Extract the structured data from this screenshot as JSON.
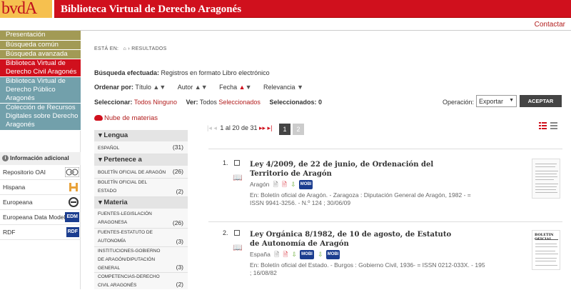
{
  "header": {
    "logo": "bvdA",
    "site_title": "Biblioteca Virtual de Derecho Aragonés",
    "contact_label": "Contactar"
  },
  "colors": {
    "brand_red": "#d0101d",
    "logo_yellow": "#f6c04f",
    "menu_olive": "#a29a55",
    "menu_teal": "#72a0ab",
    "link_red": "#b21d1d"
  },
  "sidebar": {
    "menu": [
      "Presentación",
      "Búsqueda común",
      "Búsqueda avanzada",
      "Biblioteca Virtual de Derecho Civil Aragonés",
      "Biblioteca Virtual de Derecho Público Aragonés",
      "Colección de Recursos Digitales sobre Derecho Aragonés"
    ],
    "additional_title": "Información adicional",
    "additional": [
      {
        "label": "Repositorio OAI",
        "icon": "oai-logo"
      },
      {
        "label": "Hispana",
        "icon": "hispana-logo"
      },
      {
        "label": "Europeana",
        "icon": "europeana-logo"
      },
      {
        "label": "Europeana Data Model",
        "icon": "edm-logo",
        "badge": "EDM"
      },
      {
        "label": "RDF",
        "icon": "rdf-logo",
        "badge": "RDF"
      }
    ]
  },
  "breadcrumb": {
    "prefix": "ESTÁ EN:",
    "home_icon": "home-icon",
    "current": "RESULTADOS"
  },
  "search": {
    "label": "Búsqueda efectuada:",
    "value": "Registros en formato Libro electrónico"
  },
  "order": {
    "label": "Ordenar por:",
    "fields": [
      "Título",
      "Autor",
      "Fecha",
      "Relevancia"
    ]
  },
  "selection": {
    "label": "Seleccionar:",
    "all": "Todos",
    "none": "Ninguno",
    "view_label": "Ver:",
    "view_all": "Todos",
    "view_selected": "Seleccionados",
    "selected_label": "Seleccionados: 0"
  },
  "operation": {
    "label": "Operación:",
    "value": "Exportar",
    "button": "ACEPTAR"
  },
  "nube": "Nube de materias",
  "facets": {
    "lengua": {
      "title": "Lengua",
      "items": [
        {
          "label": "ESPAÑOL",
          "count": "(31)"
        }
      ]
    },
    "pertenece": {
      "title": "Pertenece a",
      "items": [
        {
          "label": "BOLETÍN OFICIAL DE ARAGÓN",
          "count": "(26)"
        },
        {
          "label": "BOLETÍN OFICIAL DEL ESTADO",
          "count": "(2)"
        }
      ]
    },
    "materia": {
      "title": "Materia",
      "items": [
        {
          "label": "FUENTES-LEGISLACIÓN ARAGONESA",
          "count": "(26)"
        },
        {
          "label": "FUENTES-ESTATUTO DE AUTONOMÍA",
          "count": "(3)"
        },
        {
          "label": "INSTITUCIONES-GOBIERNO DE ARAGÓN/DIPUTACIÓN GENERAL",
          "count": "(3)"
        },
        {
          "label": "COMPETENCIAS-DERECHO CIVIL ARAGONÉS",
          "count": "(2)"
        }
      ]
    }
  },
  "pagination": {
    "summary": "1 al 20 de 31",
    "pages": [
      "1",
      "2"
    ],
    "current": "1"
  },
  "results": [
    {
      "num": "1.",
      "title": "Ley 4/2009, de 22 de junio, de Ordenación del Territorio de Aragón",
      "place": "Aragón",
      "formats": [
        "doc-icon",
        "pdf-icon",
        "epub-icon",
        "MOBI"
      ],
      "meta": "En: Boletín oficial de Aragón. - Zaragoza : Diputación General de Aragón, 1982 - = ISSN 9941-3256. - N.º 124 ; 30/06/09"
    },
    {
      "num": "2.",
      "title": "Ley Orgánica 8/1982, de 10 de agosto, de Estatuto de Autonomía de Aragón",
      "place": "España",
      "formats": [
        "doc-icon",
        "pdf-icon",
        "epub-icon",
        "MOBI",
        "epub-icon",
        "MOBI"
      ],
      "meta": "En: Boletín oficial del Estado. - Burgos : Gobierno Civil, 1936- = ISSN 0212-033X. - 195 ; 16/08/82"
    }
  ]
}
